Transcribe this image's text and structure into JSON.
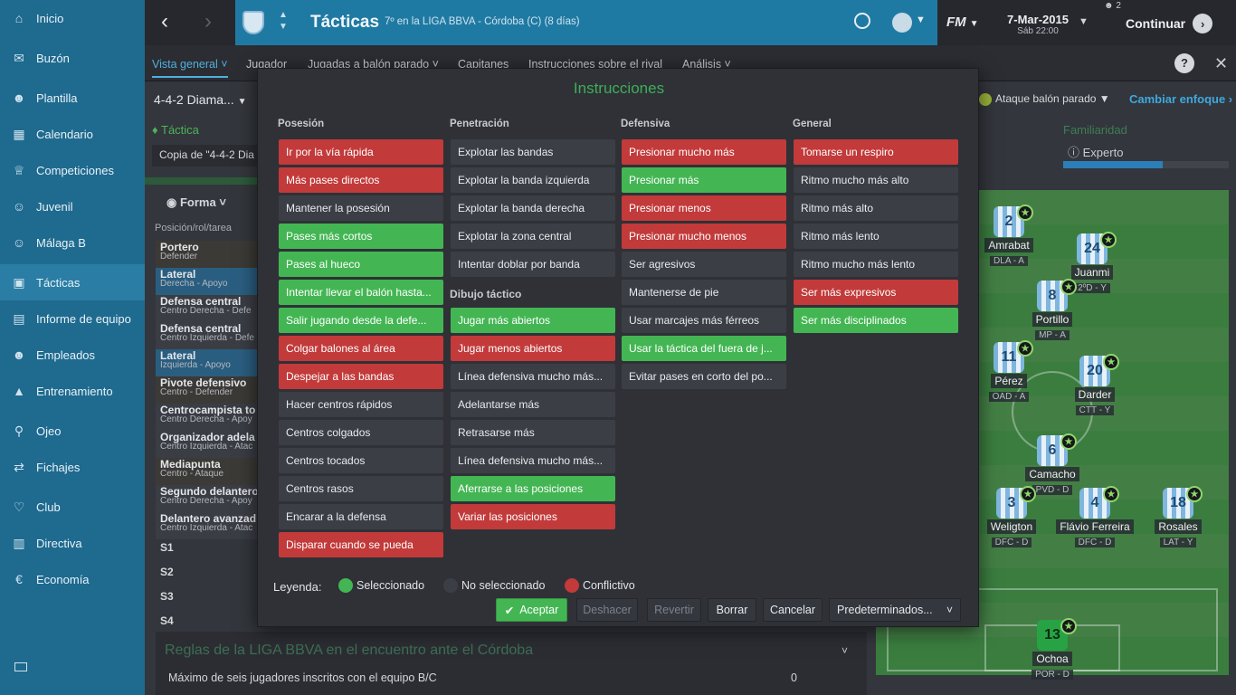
{
  "sidebar": {
    "items": [
      {
        "label": "Inicio",
        "icon": "home-icon"
      },
      {
        "label": "Buzón",
        "icon": "inbox-icon"
      },
      {
        "label": "Plantilla",
        "icon": "squad-icon"
      },
      {
        "label": "Calendario",
        "icon": "calendar-icon"
      },
      {
        "label": "Competiciones",
        "icon": "trophy-icon"
      },
      {
        "label": "Juvenil",
        "icon": "youth-icon"
      },
      {
        "label": "Málaga B",
        "icon": "reserve-icon"
      },
      {
        "label": "Tácticas",
        "icon": "tactics-icon"
      },
      {
        "label": "Informe de equipo",
        "icon": "report-icon"
      },
      {
        "label": "Empleados",
        "icon": "staff-icon"
      },
      {
        "label": "Entrenamiento",
        "icon": "training-icon"
      },
      {
        "label": "Ojeo",
        "icon": "search-icon"
      },
      {
        "label": "Fichajes",
        "icon": "transfers-icon"
      },
      {
        "label": "Club",
        "icon": "club-icon"
      },
      {
        "label": "Directiva",
        "icon": "board-icon"
      },
      {
        "label": "Economía",
        "icon": "finance-icon"
      }
    ]
  },
  "header": {
    "title": "Tácticas",
    "subtitle": "7º en la LIGA BBVA - Córdoba (C) (8 días)",
    "fm": "FM",
    "date": "7-Mar-2015",
    "time": "Sáb 22:00",
    "users": "2",
    "continue": "Continuar"
  },
  "subnav": {
    "items": [
      "Vista general",
      "Jugador",
      "Jugadas a balón parado",
      "Capitanes",
      "Instrucciones sobre el rival",
      "Análisis"
    ]
  },
  "main": {
    "formation": "4-4-2 Diama...",
    "tactic_label": "Táctica",
    "tactic_copy": "Copia de \"4-4-2 Dia",
    "forma": "Forma",
    "pos_header": "Posición/rol/tarea",
    "setpiece": "Ataque balón parado",
    "change_focus": "Cambiar enfoque",
    "familiarity": "Familiaridad",
    "expert": "Experto",
    "familiarity_level": 0.6,
    "rows": [
      {
        "role": "Portero",
        "duty": "Defender"
      },
      {
        "role": "Lateral",
        "duty": "Derecha - Apoyo"
      },
      {
        "role": "Defensa central",
        "duty": "Centro Derecha - Defe"
      },
      {
        "role": "Defensa central",
        "duty": "Centro Izquierda - Defe"
      },
      {
        "role": "Lateral",
        "duty": "Izquierda - Apoyo"
      },
      {
        "role": "Pivote defensivo",
        "duty": "Centro - Defender"
      },
      {
        "role": "Centrocampista to",
        "duty": "Centro Derecha - Apoy"
      },
      {
        "role": "Organizador adela",
        "duty": "Centro Izquierda - Atac"
      },
      {
        "role": "Mediapunta",
        "duty": "Centro - Ataque"
      },
      {
        "role": "Segundo delantero",
        "duty": "Centro Derecha - Apoy"
      },
      {
        "role": "Delantero avanzad",
        "duty": "Centro Izquierda - Atac"
      }
    ],
    "subs": [
      "S1",
      "S2",
      "S3",
      "S4"
    ],
    "rules_title": "Reglas de la LIGA BBVA en el encuentro ante el Córdoba",
    "rules_text": "Máximo de seis jugadores inscritos con el equipo B/C",
    "rules_value": "0"
  },
  "players": [
    {
      "num": "2",
      "name": "Amrabat",
      "pos": "DLA - A"
    },
    {
      "num": "24",
      "name": "Juanmi",
      "pos": "2ºD - Y"
    },
    {
      "num": "8",
      "name": "Portillo",
      "pos": "MP - A"
    },
    {
      "num": "11",
      "name": "Pérez",
      "pos": "OAD - A"
    },
    {
      "num": "20",
      "name": "Darder",
      "pos": "CTT - Y"
    },
    {
      "num": "6",
      "name": "Camacho",
      "pos": "PVD - D"
    },
    {
      "num": "3",
      "name": "Weligton",
      "pos": "DFC - D"
    },
    {
      "num": "4",
      "name": "Flávio Ferreira",
      "pos": "DFC - D"
    },
    {
      "num": "18",
      "name": "Rosales",
      "pos": "LAT - Y"
    },
    {
      "num": "13",
      "name": "Ochoa",
      "pos": "POR - D"
    }
  ],
  "modal": {
    "title": "Instrucciones",
    "columns": {
      "posesion": "Posesión",
      "penetracion": "Penetración",
      "dibujo": "Dibujo táctico",
      "defensiva": "Defensiva",
      "general": "General"
    },
    "posesion": [
      {
        "label": "Ir por la vía rápida",
        "state": "red"
      },
      {
        "label": "Más pases directos",
        "state": "red"
      },
      {
        "label": "Mantener la posesión",
        "state": "none"
      },
      {
        "label": "Pases más cortos",
        "state": "green"
      },
      {
        "label": "Pases al hueco",
        "state": "green"
      },
      {
        "label": "Intentar llevar el balón hasta...",
        "state": "green"
      },
      {
        "label": "Salir jugando desde la defe...",
        "state": "green"
      },
      {
        "label": "Colgar balones al área",
        "state": "red"
      },
      {
        "label": "Despejar a las bandas",
        "state": "red"
      },
      {
        "label": "Hacer centros rápidos",
        "state": "none"
      },
      {
        "label": "Centros colgados",
        "state": "none"
      },
      {
        "label": "Centros tocados",
        "state": "none"
      },
      {
        "label": "Centros rasos",
        "state": "none"
      },
      {
        "label": "Encarar a la defensa",
        "state": "none"
      },
      {
        "label": "Disparar cuando se pueda",
        "state": "red"
      }
    ],
    "penetracion": [
      {
        "label": "Explotar las bandas",
        "state": "none"
      },
      {
        "label": "Explotar la banda izquierda",
        "state": "none"
      },
      {
        "label": "Explotar la banda derecha",
        "state": "none"
      },
      {
        "label": "Explotar la zona central",
        "state": "none"
      },
      {
        "label": "Intentar doblar por banda",
        "state": "none"
      }
    ],
    "dibujo": [
      {
        "label": "Jugar más abiertos",
        "state": "green"
      },
      {
        "label": "Jugar menos abiertos",
        "state": "red"
      },
      {
        "label": "Línea defensiva mucho más...",
        "state": "none"
      },
      {
        "label": "Adelantarse más",
        "state": "none"
      },
      {
        "label": "Retrasarse más",
        "state": "none"
      },
      {
        "label": "Línea defensiva mucho más...",
        "state": "none"
      },
      {
        "label": "Aferrarse a las posiciones",
        "state": "green"
      },
      {
        "label": "Variar las posiciones",
        "state": "red"
      }
    ],
    "defensiva": [
      {
        "label": "Presionar mucho más",
        "state": "red"
      },
      {
        "label": "Presionar más",
        "state": "green"
      },
      {
        "label": "Presionar menos",
        "state": "red"
      },
      {
        "label": "Presionar mucho menos",
        "state": "red"
      },
      {
        "label": "Ser agresivos",
        "state": "none"
      },
      {
        "label": "Mantenerse de pie",
        "state": "none"
      },
      {
        "label": "Usar marcajes más férreos",
        "state": "none"
      },
      {
        "label": "Usar la táctica del fuera de j...",
        "state": "green"
      },
      {
        "label": "Evitar pases en corto del po...",
        "state": "none"
      }
    ],
    "general": [
      {
        "label": "Tomarse un respiro",
        "state": "red"
      },
      {
        "label": "Ritmo mucho más alto",
        "state": "none"
      },
      {
        "label": "Ritmo más alto",
        "state": "none"
      },
      {
        "label": "Ritmo más lento",
        "state": "none"
      },
      {
        "label": "Ritmo mucho más lento",
        "state": "none"
      },
      {
        "label": "Ser más expresivos",
        "state": "red"
      },
      {
        "label": "Ser más disciplinados",
        "state": "green"
      }
    ],
    "legend": {
      "label": "Leyenda:",
      "selected": "Seleccionado",
      "unselected": "No seleccionado",
      "conflict": "Conflictivo"
    },
    "buttons": {
      "accept": "Aceptar",
      "undo": "Deshacer",
      "revert": "Revertir",
      "clear": "Borrar",
      "cancel": "Cancelar",
      "defaults": "Predeterminados..."
    }
  },
  "colors": {
    "green": "#43b653",
    "red": "#c23a3a",
    "sidebar": "#1f6a8f",
    "header": "#1f7aa3"
  }
}
